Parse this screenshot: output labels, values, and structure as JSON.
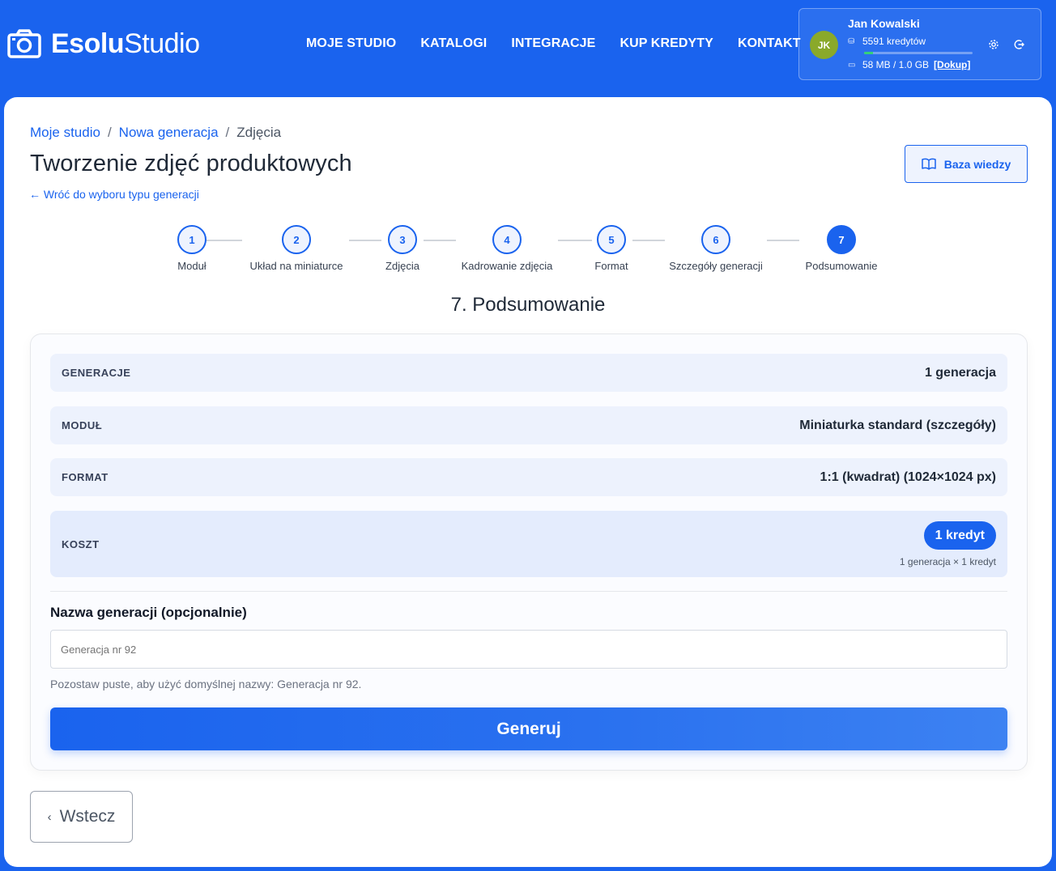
{
  "header": {
    "brand_bold": "Esolu",
    "brand_light": "Studio",
    "nav": [
      "MOJE STUDIO",
      "KATALOGI",
      "INTEGRACJE",
      "KUP KREDYTY",
      "KONTAKT"
    ]
  },
  "user": {
    "initials": "JK",
    "name": "Jan Kowalski",
    "credits": "5591 kredytów",
    "credit_fill_fraction": 0.08,
    "storage": "58 MB / 1.0 GB",
    "topup_label": "[Dokup]",
    "avatar_color": "#8aa92a"
  },
  "breadcrumb": [
    "Moje studio",
    "Nowa generacja",
    "Zdjęcia"
  ],
  "page": {
    "title": "Tworzenie zdjęć produktowych",
    "back_link": "← Wróć do wyboru typu generacji",
    "kb_button": "Baza wiedzy"
  },
  "steps": [
    {
      "num": "1",
      "label": "Moduł"
    },
    {
      "num": "2",
      "label": "Układ na miniaturce"
    },
    {
      "num": "3",
      "label": "Zdjęcia"
    },
    {
      "num": "4",
      "label": "Kadrowanie zdjęcia"
    },
    {
      "num": "5",
      "label": "Format"
    },
    {
      "num": "6",
      "label": "Szczegóły generacji"
    },
    {
      "num": "7",
      "label": "Podsumowanie"
    }
  ],
  "active_step": 7,
  "section_title": "7. Podsumowanie",
  "summary": {
    "generations_key": "GENERACJE",
    "generations_val": "1 generacja",
    "module_key": "MODUŁ",
    "module_val": "Miniaturka standard (szczegóły)",
    "format_key": "FORMAT",
    "format_val": "1:1 (kwadrat) (1024×1024 px)",
    "cost_key": "KOSZT",
    "cost_val": "1 kredyt",
    "cost_sub": "1 generacja × 1 kredyt"
  },
  "form": {
    "name_label": "Nazwa generacji (opcjonalnie)",
    "name_placeholder": "Generacja nr 92",
    "hint": "Pozostaw puste, aby użyć domyślnej nazwy: Generacja nr 92.",
    "generate_label": "Generuj",
    "back_label": "Wstecz"
  },
  "colors": {
    "accent": "#1a63ee",
    "row_bg": "#edf2fd",
    "credit_bar": "#35d07a"
  }
}
